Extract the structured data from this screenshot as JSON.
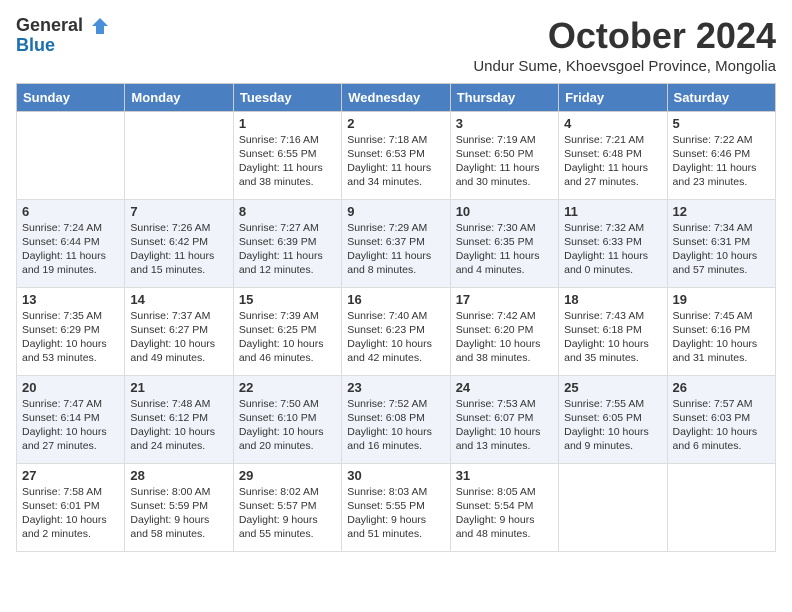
{
  "logo": {
    "line1": "General",
    "line2": "Blue"
  },
  "title": "October 2024",
  "location": "Undur Sume, Khoevsgoel Province, Mongolia",
  "weekdays": [
    "Sunday",
    "Monday",
    "Tuesday",
    "Wednesday",
    "Thursday",
    "Friday",
    "Saturday"
  ],
  "weeks": [
    [
      {
        "day": "",
        "info": ""
      },
      {
        "day": "",
        "info": ""
      },
      {
        "day": "1",
        "info": "Sunrise: 7:16 AM\nSunset: 6:55 PM\nDaylight: 11 hours and 38 minutes."
      },
      {
        "day": "2",
        "info": "Sunrise: 7:18 AM\nSunset: 6:53 PM\nDaylight: 11 hours and 34 minutes."
      },
      {
        "day": "3",
        "info": "Sunrise: 7:19 AM\nSunset: 6:50 PM\nDaylight: 11 hours and 30 minutes."
      },
      {
        "day": "4",
        "info": "Sunrise: 7:21 AM\nSunset: 6:48 PM\nDaylight: 11 hours and 27 minutes."
      },
      {
        "day": "5",
        "info": "Sunrise: 7:22 AM\nSunset: 6:46 PM\nDaylight: 11 hours and 23 minutes."
      }
    ],
    [
      {
        "day": "6",
        "info": "Sunrise: 7:24 AM\nSunset: 6:44 PM\nDaylight: 11 hours and 19 minutes."
      },
      {
        "day": "7",
        "info": "Sunrise: 7:26 AM\nSunset: 6:42 PM\nDaylight: 11 hours and 15 minutes."
      },
      {
        "day": "8",
        "info": "Sunrise: 7:27 AM\nSunset: 6:39 PM\nDaylight: 11 hours and 12 minutes."
      },
      {
        "day": "9",
        "info": "Sunrise: 7:29 AM\nSunset: 6:37 PM\nDaylight: 11 hours and 8 minutes."
      },
      {
        "day": "10",
        "info": "Sunrise: 7:30 AM\nSunset: 6:35 PM\nDaylight: 11 hours and 4 minutes."
      },
      {
        "day": "11",
        "info": "Sunrise: 7:32 AM\nSunset: 6:33 PM\nDaylight: 11 hours and 0 minutes."
      },
      {
        "day": "12",
        "info": "Sunrise: 7:34 AM\nSunset: 6:31 PM\nDaylight: 10 hours and 57 minutes."
      }
    ],
    [
      {
        "day": "13",
        "info": "Sunrise: 7:35 AM\nSunset: 6:29 PM\nDaylight: 10 hours and 53 minutes."
      },
      {
        "day": "14",
        "info": "Sunrise: 7:37 AM\nSunset: 6:27 PM\nDaylight: 10 hours and 49 minutes."
      },
      {
        "day": "15",
        "info": "Sunrise: 7:39 AM\nSunset: 6:25 PM\nDaylight: 10 hours and 46 minutes."
      },
      {
        "day": "16",
        "info": "Sunrise: 7:40 AM\nSunset: 6:23 PM\nDaylight: 10 hours and 42 minutes."
      },
      {
        "day": "17",
        "info": "Sunrise: 7:42 AM\nSunset: 6:20 PM\nDaylight: 10 hours and 38 minutes."
      },
      {
        "day": "18",
        "info": "Sunrise: 7:43 AM\nSunset: 6:18 PM\nDaylight: 10 hours and 35 minutes."
      },
      {
        "day": "19",
        "info": "Sunrise: 7:45 AM\nSunset: 6:16 PM\nDaylight: 10 hours and 31 minutes."
      }
    ],
    [
      {
        "day": "20",
        "info": "Sunrise: 7:47 AM\nSunset: 6:14 PM\nDaylight: 10 hours and 27 minutes."
      },
      {
        "day": "21",
        "info": "Sunrise: 7:48 AM\nSunset: 6:12 PM\nDaylight: 10 hours and 24 minutes."
      },
      {
        "day": "22",
        "info": "Sunrise: 7:50 AM\nSunset: 6:10 PM\nDaylight: 10 hours and 20 minutes."
      },
      {
        "day": "23",
        "info": "Sunrise: 7:52 AM\nSunset: 6:08 PM\nDaylight: 10 hours and 16 minutes."
      },
      {
        "day": "24",
        "info": "Sunrise: 7:53 AM\nSunset: 6:07 PM\nDaylight: 10 hours and 13 minutes."
      },
      {
        "day": "25",
        "info": "Sunrise: 7:55 AM\nSunset: 6:05 PM\nDaylight: 10 hours and 9 minutes."
      },
      {
        "day": "26",
        "info": "Sunrise: 7:57 AM\nSunset: 6:03 PM\nDaylight: 10 hours and 6 minutes."
      }
    ],
    [
      {
        "day": "27",
        "info": "Sunrise: 7:58 AM\nSunset: 6:01 PM\nDaylight: 10 hours and 2 minutes."
      },
      {
        "day": "28",
        "info": "Sunrise: 8:00 AM\nSunset: 5:59 PM\nDaylight: 9 hours and 58 minutes."
      },
      {
        "day": "29",
        "info": "Sunrise: 8:02 AM\nSunset: 5:57 PM\nDaylight: 9 hours and 55 minutes."
      },
      {
        "day": "30",
        "info": "Sunrise: 8:03 AM\nSunset: 5:55 PM\nDaylight: 9 hours and 51 minutes."
      },
      {
        "day": "31",
        "info": "Sunrise: 8:05 AM\nSunset: 5:54 PM\nDaylight: 9 hours and 48 minutes."
      },
      {
        "day": "",
        "info": ""
      },
      {
        "day": "",
        "info": ""
      }
    ]
  ]
}
